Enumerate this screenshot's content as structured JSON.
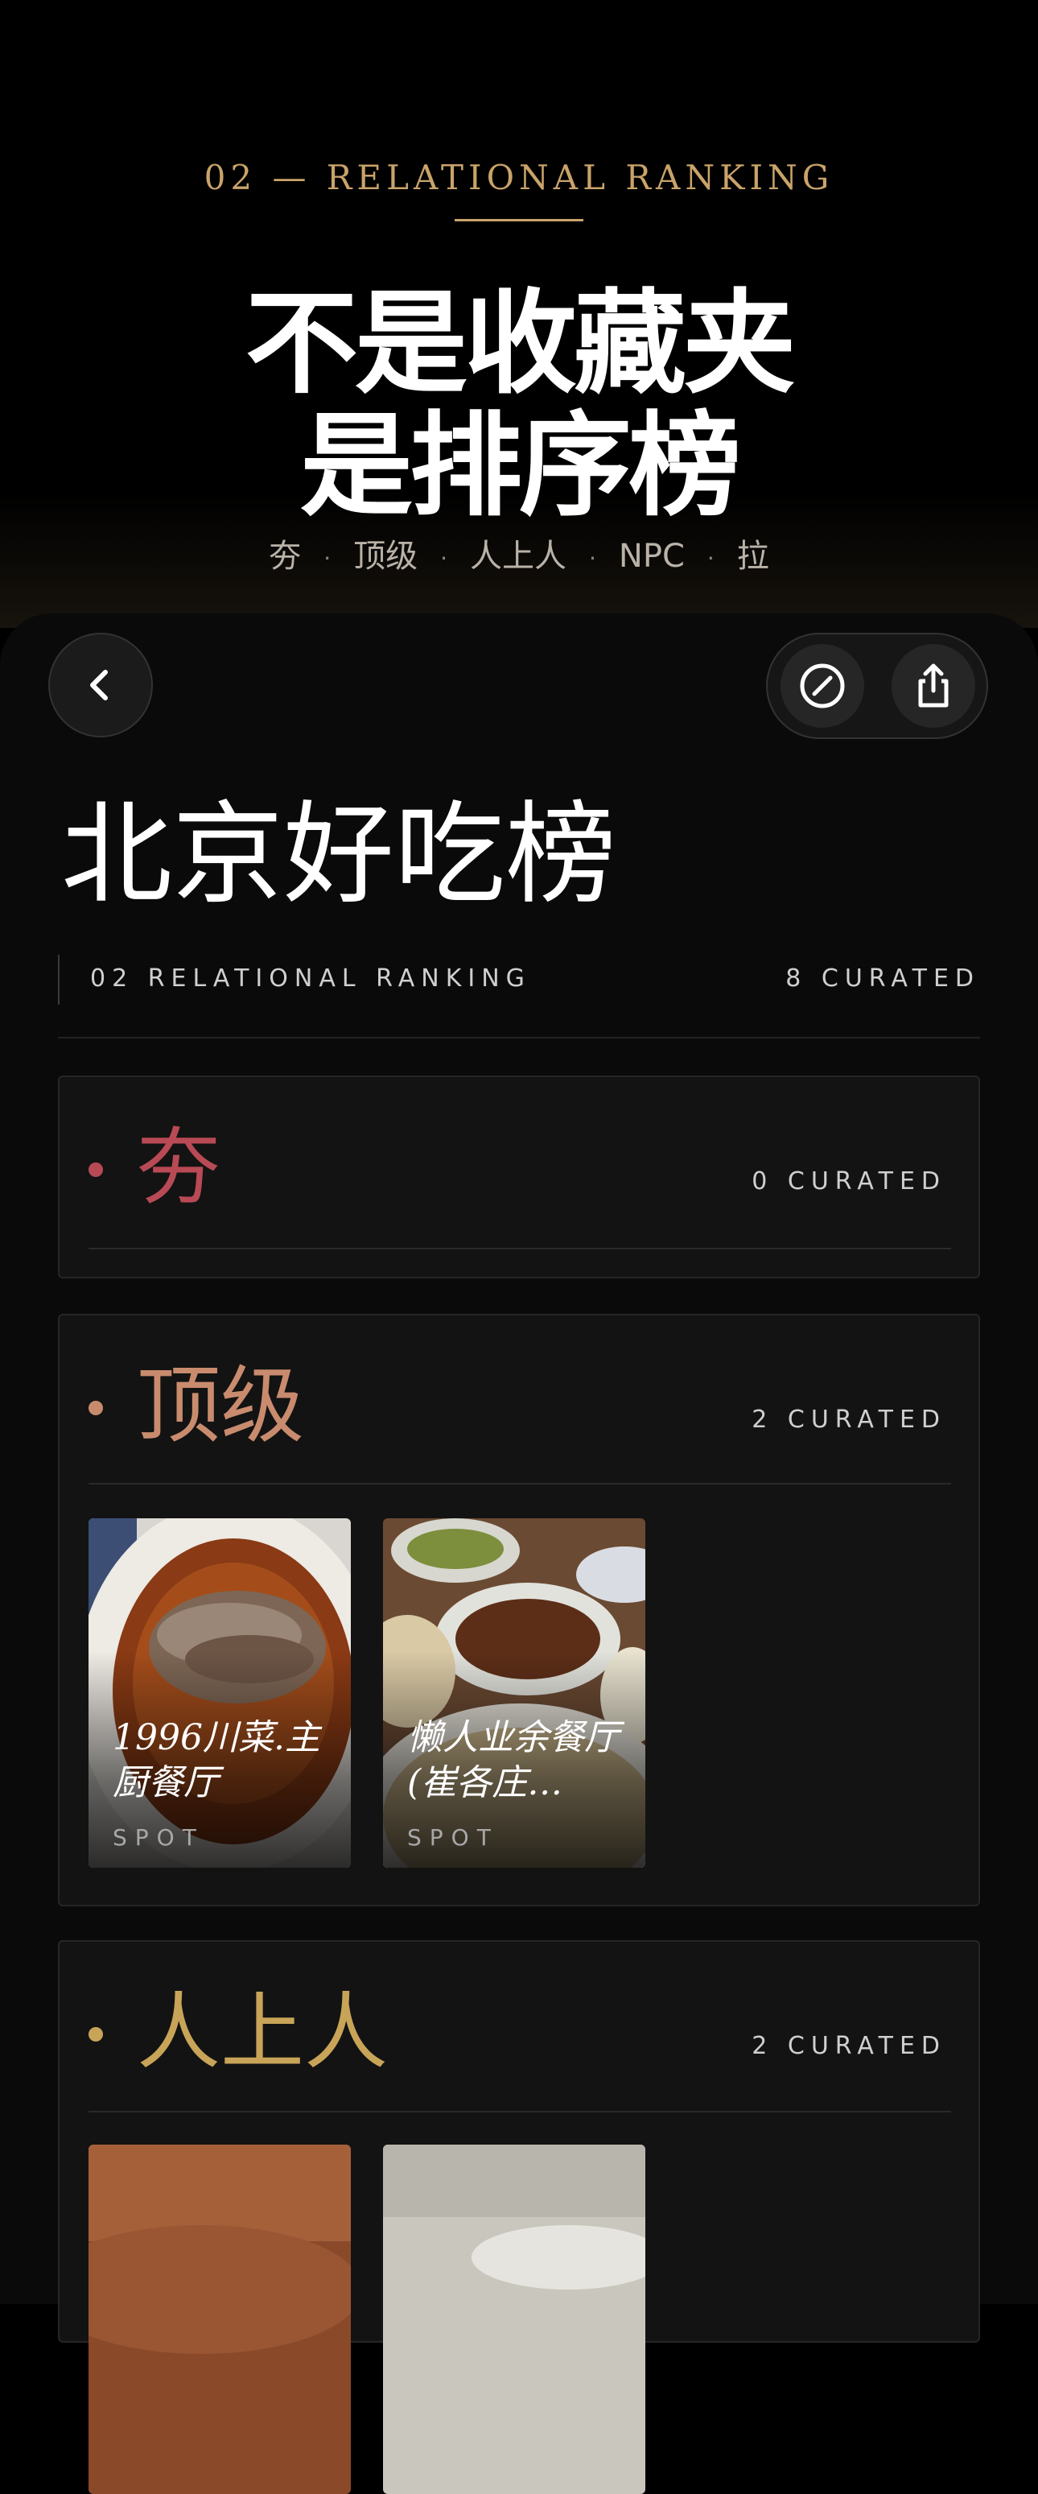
{
  "promo": {
    "eyebrow": "02 — RELATIONAL RANKING",
    "headline_line1": "不是收藏夹",
    "headline_line2": "是排序榜",
    "tiers": [
      "夯",
      "顶级",
      "人上人",
      "NPC",
      "拉"
    ],
    "tier_separator": "·"
  },
  "nav": {
    "back_icon": "chevron-left-icon",
    "edit_icon": "compass-icon",
    "share_icon": "share-icon"
  },
  "list": {
    "title": "北京好吃榜",
    "subtitle": "02 RELATIONAL RANKING",
    "total": "8 CURATED"
  },
  "sections": [
    {
      "name": "夯",
      "count": "0 CURATED",
      "color": "#b84a55",
      "cards": []
    },
    {
      "name": "顶级",
      "count": "2 CURATED",
      "color": "#c98b6e",
      "cards": [
        {
          "title": "1996川菜.主厨餐厅",
          "tag": "SPOT",
          "photo": "sliced-meat-in-chili-oil"
        },
        {
          "title": "懒人业余餐厅 (崔各庄…",
          "tag": "SPOT",
          "photo": "table-of-dishes"
        }
      ]
    },
    {
      "name": "人上人",
      "count": "2 CURATED",
      "color": "#c8a458",
      "cards": [
        {
          "title": "",
          "tag": "",
          "photo": "wood-table-dish"
        },
        {
          "title": "",
          "tag": "",
          "photo": "white-plates"
        }
      ]
    }
  ],
  "colors": {
    "accent_gold": "#c9a36a",
    "background": "#000000",
    "panel": "#0a0a0a",
    "section": "#131313"
  }
}
